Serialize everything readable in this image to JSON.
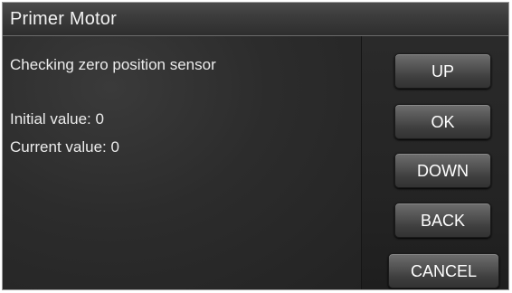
{
  "title_bar": {
    "title": "Primer Motor"
  },
  "content": {
    "status": "Checking zero position sensor",
    "initial_value": "Initial value: 0",
    "current_value": "Current value: 0"
  },
  "buttons": {
    "up": "UP",
    "ok": "OK",
    "down": "DOWN",
    "back": "BACK",
    "cancel": "CANCEL"
  },
  "colors": {
    "background": "#202020",
    "text": "#ececec",
    "button_top": "#6e6e6e",
    "button_bottom": "#333333"
  }
}
